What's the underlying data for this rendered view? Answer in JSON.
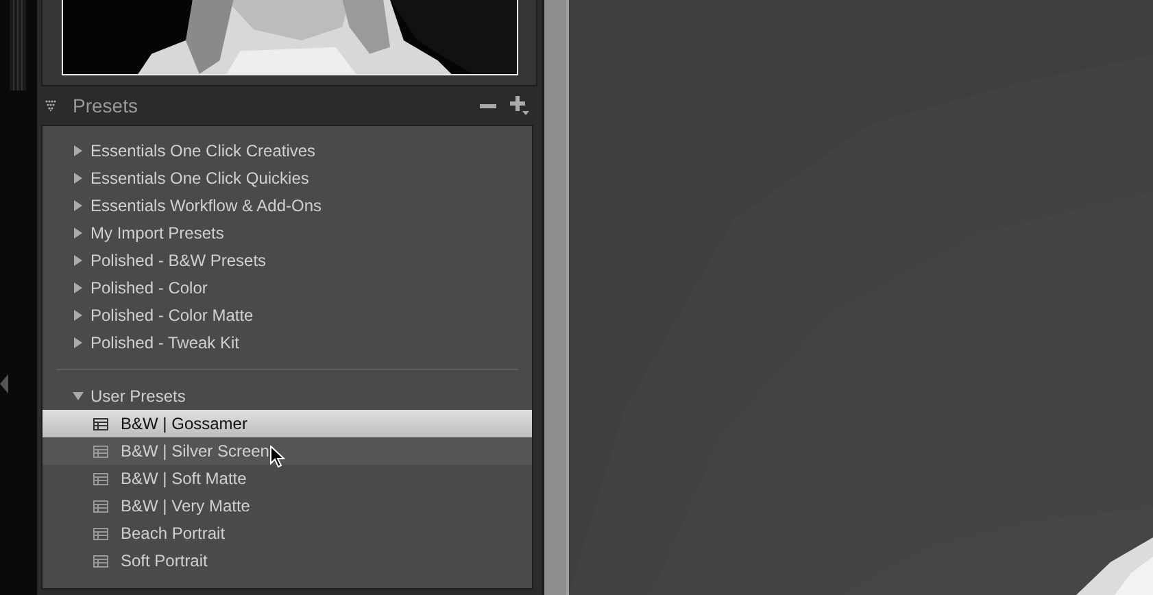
{
  "panel": {
    "title": "Presets"
  },
  "preset_folders": [
    {
      "name": "Essentials One Click Creatives",
      "expanded": false
    },
    {
      "name": "Essentials One Click Quickies",
      "expanded": false
    },
    {
      "name": "Essentials Workflow & Add-Ons",
      "expanded": false
    },
    {
      "name": "My Import Presets",
      "expanded": false
    },
    {
      "name": "Polished - B&W Presets",
      "expanded": false
    },
    {
      "name": "Polished - Color",
      "expanded": false
    },
    {
      "name": "Polished - Color Matte",
      "expanded": false
    },
    {
      "name": "Polished - Tweak Kit",
      "expanded": false
    }
  ],
  "user_folder": {
    "name": "User Presets",
    "expanded": true,
    "children": [
      {
        "name": "B&W | Gossamer",
        "selected": true,
        "hovered": false
      },
      {
        "name": "B&W | Silver Screen",
        "selected": false,
        "hovered": true
      },
      {
        "name": "B&W | Soft Matte",
        "selected": false,
        "hovered": false
      },
      {
        "name": "B&W | Very Matte",
        "selected": false,
        "hovered": false
      },
      {
        "name": "Beach Portrait",
        "selected": false,
        "hovered": false
      },
      {
        "name": "Soft Portrait",
        "selected": false,
        "hovered": false
      }
    ]
  }
}
